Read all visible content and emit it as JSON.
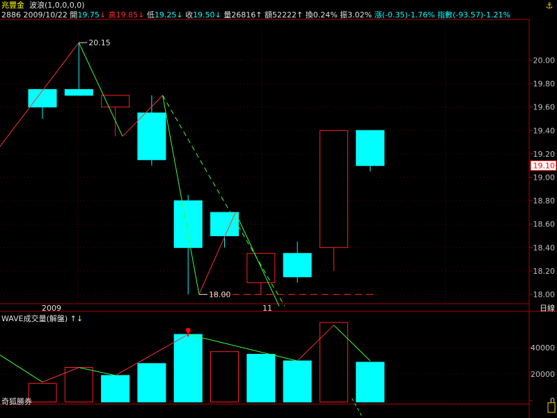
{
  "header": {
    "stock_name": "兆豐金",
    "indicator": "波浪(1,0,0,0,0)",
    "code": "2886",
    "date": "2009/10/22",
    "open_label": "開",
    "open_value": "19.75",
    "open_arrow": "↓",
    "high_label": "高",
    "high_value": "19.85",
    "high_arrow": "↓",
    "low_label": "低",
    "low_value": "19.25",
    "low_arrow": "↓",
    "close_label": "收",
    "close_value": "19.50",
    "close_arrow": "↓",
    "volume_label": "量",
    "volume_value": "26816",
    "volume_arrow": "↑",
    "amount_label": "額",
    "amount_value": "52222",
    "amount_arrow": "↑",
    "turnover_label": "換",
    "turnover_value": "0.24%",
    "amplitude_label": "振",
    "amplitude_value": "3.02%",
    "change_label": "漲",
    "change_value": "(-0.35)-1.76%",
    "index_label": "指數",
    "index_value": "(-93.57)-1.21%"
  },
  "icons": {
    "top_right": "anchor-icon",
    "right_edge": "scroll-icon"
  },
  "lower_panel": {
    "title": "WAVE成交量(解盤)",
    "up_arrow": "↑",
    "down_arrow": "↓"
  },
  "footer": {
    "broker": "奇狐勝券"
  },
  "colors": {
    "up": "#ff2020",
    "down": "#00ffff",
    "wave_up": "#ff3030",
    "wave_down": "#40ff40",
    "axis": "#b00000",
    "label": "#c0c0c0"
  },
  "chart_data": [
    {
      "type": "candlestick",
      "ylim": [
        17.92,
        20.3
      ],
      "yticks": [
        "20.00",
        "19.80",
        "19.60",
        "19.40",
        "19.20",
        "19.00",
        "18.80",
        "18.60",
        "18.40",
        "18.20",
        "18.00"
      ],
      "current_price_label": "19.10",
      "current_price": 19.1,
      "x_labels": [
        "2009",
        "11"
      ],
      "period_label": "日線",
      "candles": [
        {
          "open": 19.75,
          "high": 19.75,
          "low": 19.5,
          "close": 19.6
        },
        {
          "open": 19.75,
          "high": 20.15,
          "low": 19.7,
          "close": 19.7
        },
        {
          "open": 19.6,
          "high": 19.7,
          "low": 19.35,
          "close": 19.7
        },
        {
          "open": 19.55,
          "high": 19.7,
          "low": 19.1,
          "close": 19.15
        },
        {
          "open": 18.8,
          "high": 18.85,
          "low": 18.0,
          "close": 18.4
        },
        {
          "open": 18.7,
          "high": 18.7,
          "low": 18.4,
          "close": 18.5
        },
        {
          "open": 18.1,
          "high": 18.35,
          "low": 18.0,
          "close": 18.35
        },
        {
          "open": 18.35,
          "high": 18.45,
          "low": 18.1,
          "close": 18.15
        },
        {
          "open": 18.4,
          "high": 19.4,
          "low": 18.2,
          "close": 19.4
        },
        {
          "open": 19.4,
          "high": 19.4,
          "low": 19.05,
          "close": 19.1
        }
      ],
      "wave_points": [
        {
          "i": -1.2,
          "v": 19.25
        },
        {
          "i": 1.0,
          "v": 20.15
        },
        {
          "i": 2.2,
          "v": 19.35
        },
        {
          "i": 3.3,
          "v": 19.7
        },
        {
          "i": 4.3,
          "v": 18.0
        },
        {
          "i": 5.3,
          "v": 18.7
        },
        {
          "i": 6.5,
          "v": 17.9
        }
      ],
      "wave_dashed": [
        {
          "i": 3.3,
          "v": 19.7
        },
        {
          "i": 6.65,
          "v": 17.9
        }
      ],
      "support_line": {
        "from_i": 4.3,
        "to_i": 9.2,
        "v": 18.0
      },
      "annotations": [
        {
          "text": "20.15",
          "i": 1.0,
          "v": 20.15
        },
        {
          "text": "18.00",
          "i": 4.3,
          "v": 18.0
        }
      ]
    },
    {
      "type": "bar",
      "ylim": [
        0,
        50000
      ],
      "yticks": [
        "40000",
        "20000",
        "0"
      ],
      "values": [
        13000,
        25000,
        19000,
        28000,
        50000,
        37000,
        35000,
        30000,
        59000,
        29000
      ],
      "up": [
        true,
        true,
        false,
        false,
        false,
        true,
        false,
        false,
        true,
        false
      ],
      "wave_points": [
        {
          "i": -1.2,
          "v": 35000
        },
        {
          "i": 0.0,
          "v": 14000
        },
        {
          "i": 1.0,
          "v": 25000
        },
        {
          "i": 2.0,
          "v": 19000
        },
        {
          "i": 4.0,
          "v": 50000
        },
        {
          "i": 7.0,
          "v": 30000
        },
        {
          "i": 8.0,
          "v": 57000
        },
        {
          "i": 9.0,
          "v": 30000
        }
      ]
    }
  ]
}
